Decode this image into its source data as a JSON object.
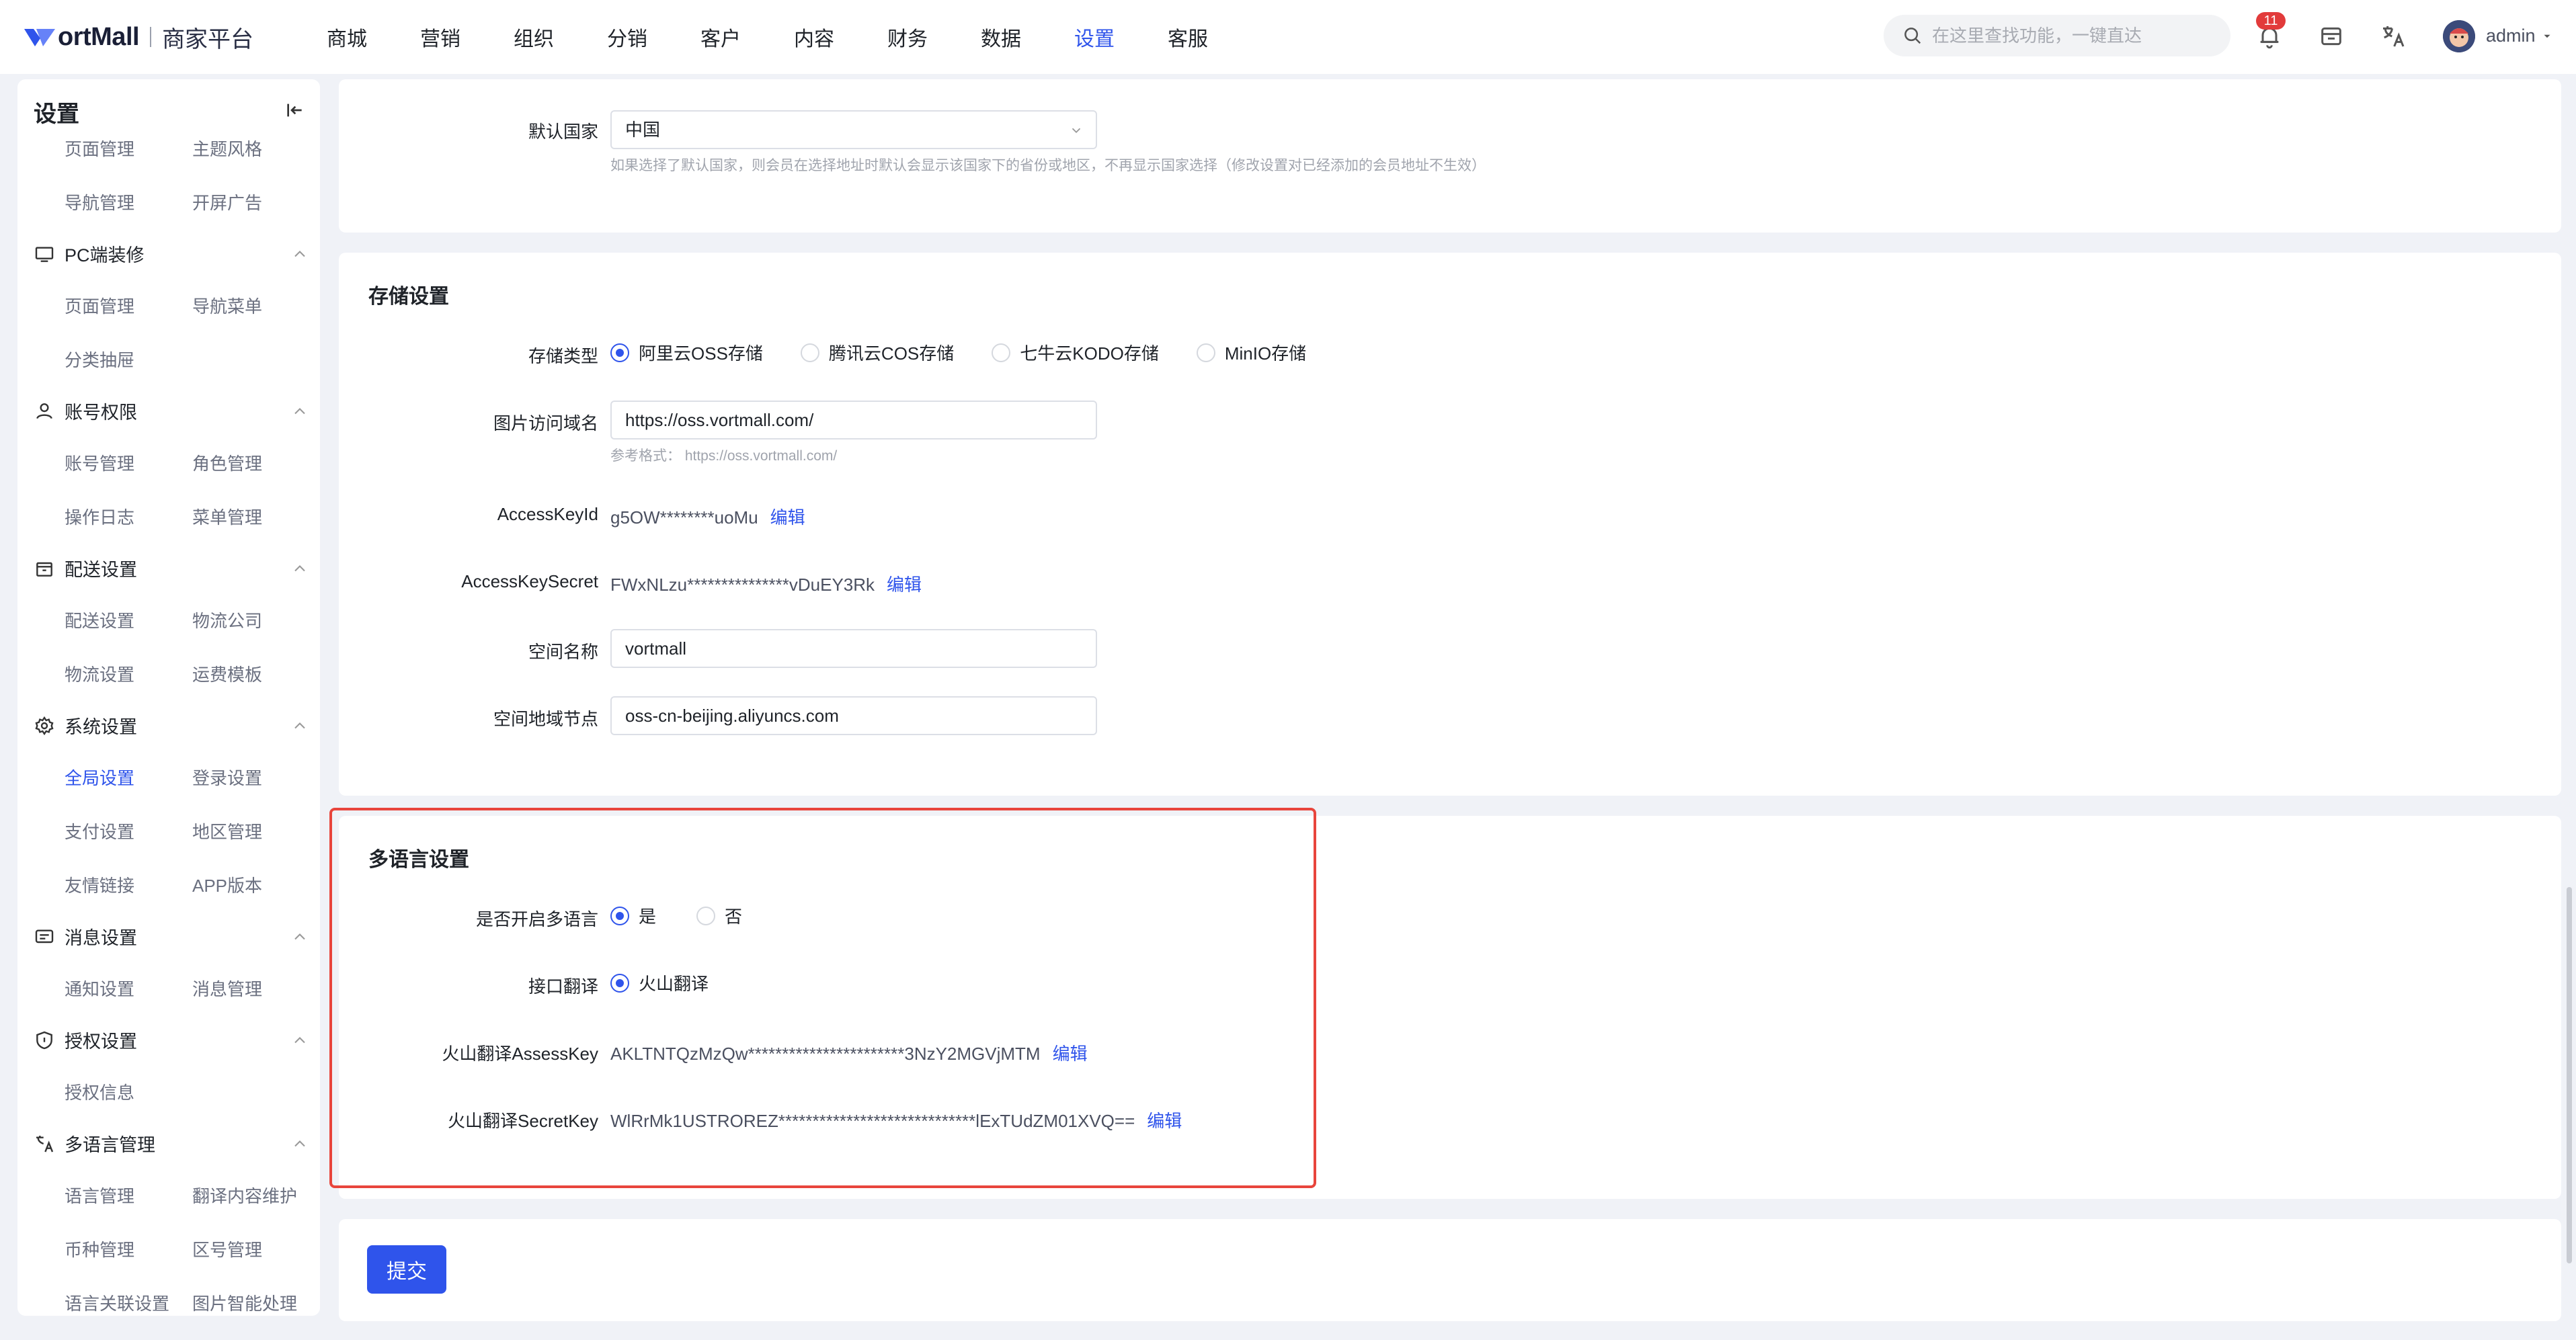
{
  "app": {
    "logo_text": "ortMall",
    "logo_sub": "商家平台"
  },
  "topnav": [
    "商城",
    "营销",
    "组织",
    "分销",
    "客户",
    "内容",
    "财务",
    "数据",
    "设置",
    "客服"
  ],
  "topnav_active": "设置",
  "search": {
    "placeholder": "在这里查找功能，一键直达"
  },
  "notifications": {
    "count": "11"
  },
  "user": {
    "name": "admin"
  },
  "sidebar": {
    "title": "设置",
    "groups": [
      {
        "label": "PC端装修",
        "icon": "monitor-icon"
      },
      {
        "label": "账号权限",
        "icon": "user-icon"
      },
      {
        "label": "配送设置",
        "icon": "box-icon"
      },
      {
        "label": "系统设置",
        "icon": "gear-icon"
      },
      {
        "label": "消息设置",
        "icon": "message-icon"
      },
      {
        "label": "授权设置",
        "icon": "shield-icon"
      },
      {
        "label": "多语言管理",
        "icon": "translate-icon"
      }
    ],
    "items": {
      "r0": [
        "页面管理",
        "主题风格"
      ],
      "r1": [
        "导航管理",
        "开屏广告"
      ],
      "r2": [
        "页面管理",
        "导航菜单"
      ],
      "r3": [
        "分类抽屉"
      ],
      "r4": [
        "账号管理",
        "角色管理"
      ],
      "r5": [
        "操作日志",
        "菜单管理"
      ],
      "r6": [
        "配送设置",
        "物流公司"
      ],
      "r7": [
        "物流设置",
        "运费模板"
      ],
      "r8": [
        "全局设置",
        "登录设置"
      ],
      "r9": [
        "支付设置",
        "地区管理"
      ],
      "r10": [
        "友情链接",
        "APP版本"
      ],
      "r11": [
        "通知设置",
        "消息管理"
      ],
      "r12": [
        "授权信息"
      ],
      "r13": [
        "语言管理",
        "翻译内容维护"
      ],
      "r14": [
        "币种管理",
        "区号管理"
      ],
      "r15": [
        "语言关联设置",
        "图片智能处理"
      ]
    },
    "active_item": "全局设置"
  },
  "country": {
    "label": "默认国家",
    "value": "中国",
    "hint": "如果选择了默认国家，则会员在选择地址时默认会显示该国家下的省份或地区，不再显示国家选择（修改设置对已经添加的会员地址不生效）"
  },
  "storage": {
    "title": "存储设置",
    "type_label": "存储类型",
    "types": [
      "阿里云OSS存储",
      "腾讯云COS存储",
      "七牛云KODO存储",
      "MinIO存储"
    ],
    "type_selected": "阿里云OSS存储",
    "domain_label": "图片访问域名",
    "domain_value": "https://oss.vortmall.com/",
    "domain_hint": "参考格式：  https://oss.vortmall.com/",
    "access_key_id_label": "AccessKeyId",
    "access_key_id_value": "g5OW********uoMu",
    "access_key_secret_label": "AccessKeySecret",
    "access_key_secret_value": "FWxNLzu***************vDuEY3Rk",
    "bucket_label": "空间名称",
    "bucket_value": "vortmall",
    "region_label": "空间地域节点",
    "region_value": "oss-cn-beijing.aliyuncs.com",
    "edit_label": "编辑"
  },
  "multilang": {
    "title": "多语言设置",
    "enable_label": "是否开启多语言",
    "enable_options": [
      "是",
      "否"
    ],
    "enable_selected": "是",
    "api_label": "接口翻译",
    "api_option": "火山翻译",
    "assess_key_label": "火山翻译AssessKey",
    "assess_key_value": "AKLTNTQzMzQw***********************3NzY2MGVjMTM",
    "secret_key_label": "火山翻译SecretKey",
    "secret_key_value": "WlRrMk1USTROREZ*****************************lExTUdZM01XVQ==",
    "edit_label": "编辑"
  },
  "submit_label": "提交",
  "colors": {
    "accent": "#2f54eb",
    "highlight": "#e8453c",
    "badge": "#e23b3b"
  }
}
